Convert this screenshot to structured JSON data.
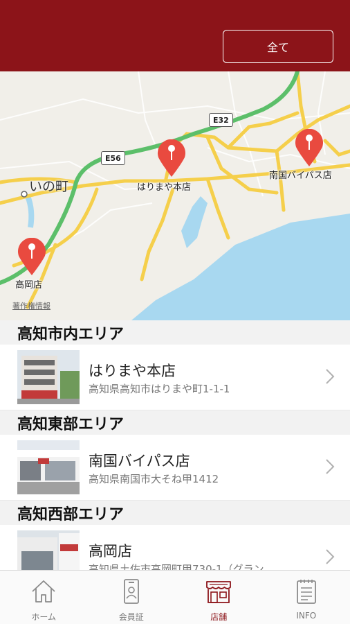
{
  "header": {
    "filter_label": "全て"
  },
  "map": {
    "town_label": "いの町",
    "credit": "著作権情報",
    "shields": [
      "E32",
      "E56"
    ],
    "pins": [
      {
        "label": "はりまや本店"
      },
      {
        "label": "南国バイパス店"
      },
      {
        "label": "高岡店"
      }
    ]
  },
  "sections": [
    {
      "title": "高知市内エリア",
      "stores": [
        {
          "name": "はりまや本店",
          "address": "高知県高知市はりまや町1-1-1"
        }
      ]
    },
    {
      "title": "高知東部エリア",
      "stores": [
        {
          "name": "南国バイパス店",
          "address": "高知県南国市大そね甲1412"
        }
      ]
    },
    {
      "title": "高知西部エリア",
      "stores": [
        {
          "name": "高岡店",
          "address": "高知県土佐市高岡町甲730-1（グラン"
        }
      ]
    }
  ],
  "tabbar": {
    "items": [
      {
        "label": "ホーム",
        "icon": "home-icon"
      },
      {
        "label": "会員証",
        "icon": "member-card-icon"
      },
      {
        "label": "店舗",
        "icon": "store-icon"
      },
      {
        "label": "INFO",
        "icon": "info-icon"
      }
    ],
    "active_color": "#8c1419"
  },
  "colors": {
    "brand": "#8c1419",
    "sea": "#a8d8f0",
    "highway": "#5cbf6a",
    "road": "#f5cf4b"
  }
}
